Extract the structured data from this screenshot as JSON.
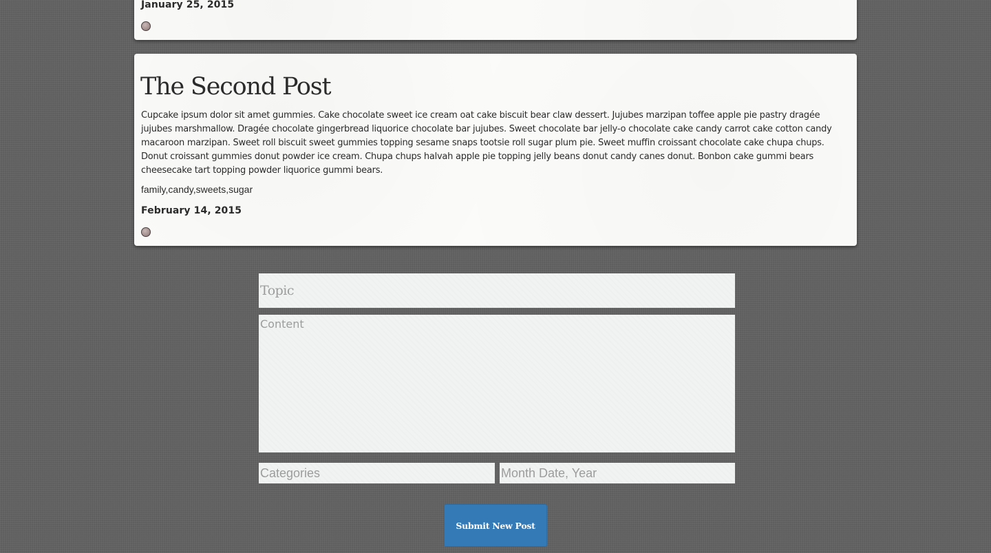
{
  "posts": [
    {
      "date": "January 25, 2015"
    },
    {
      "title": "The Second Post",
      "content": "Cupcake ipsum dolor sit amet gummies. Cake chocolate sweet ice cream oat cake biscuit bear claw dessert. Jujubes marzipan toffee apple pie pastry dragée jujubes marshmallow. Dragée chocolate gingerbread liquorice chocolate bar jujubes. Sweet chocolate bar jelly-o chocolate cake candy carrot cake cotton candy macaroon marzipan. Sweet roll biscuit sweet gummies topping sesame snaps tootsie roll sugar plum pie. Sweet muffin croissant chocolate cake chupa chups. Donut croissant gummies donut powder ice cream. Chupa chups halvah apple pie topping jelly beans donut candy canes donut. Bonbon cake gummi bears cheesecake tart topping powder liquorice gummi bears.",
      "tags": "family,candy,sweets,sugar",
      "date": "February 14, 2015"
    }
  ],
  "form": {
    "topic_placeholder": "Topic",
    "content_placeholder": "Content",
    "categories_placeholder": "Categories",
    "date_placeholder": "Month Date, Year",
    "submit_label": "Submit New Post"
  },
  "colors": {
    "background": "#5f5f5f",
    "card": "#fbfbf9",
    "field": "#f1f3f3",
    "submit_button": "#337ab7"
  }
}
